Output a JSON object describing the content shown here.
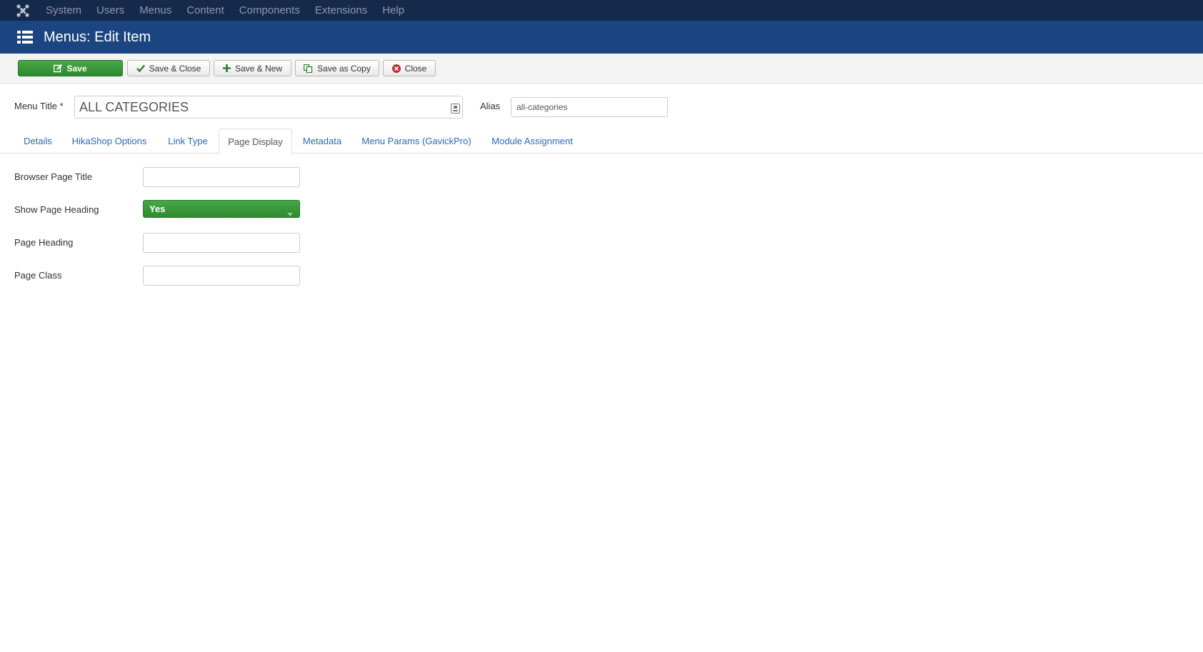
{
  "nav": {
    "logo_icon": "joomla-icon",
    "items": [
      "System",
      "Users",
      "Menus",
      "Content",
      "Components",
      "Extensions",
      "Help"
    ]
  },
  "header": {
    "icon": "list-icon",
    "title": "Menus: Edit Item"
  },
  "toolbar": {
    "save": "Save",
    "save_close": "Save & Close",
    "save_new": "Save & New",
    "save_copy": "Save as Copy",
    "close": "Close"
  },
  "form": {
    "menu_title_label": "Menu Title *",
    "menu_title_value": "ALL CATEGORIES",
    "alias_label": "Alias",
    "alias_value": "all-categories"
  },
  "tabs": [
    "Details",
    "HikaShop Options",
    "Link Type",
    "Page Display",
    "Metadata",
    "Menu Params (GavickPro)",
    "Module Assignment"
  ],
  "active_tab": "Page Display",
  "page_display": {
    "browser_page_title_label": "Browser Page Title",
    "browser_page_title_value": "",
    "show_page_heading_label": "Show Page Heading",
    "show_page_heading_value": "Yes",
    "page_heading_label": "Page Heading",
    "page_heading_value": "",
    "page_class_label": "Page Class",
    "page_class_value": ""
  },
  "colors": {
    "navbar": "#15294a",
    "title_bar": "#1b4580",
    "save_green": "#2f8a2f",
    "link_blue": "#2a69b8"
  }
}
